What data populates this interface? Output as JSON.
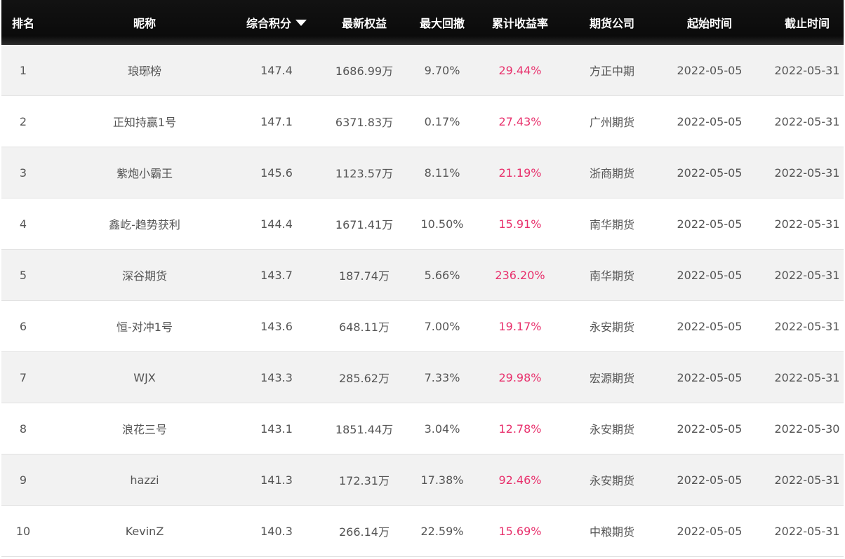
{
  "columns": {
    "rank": "排名",
    "nickname": "昵称",
    "score": "综合积分",
    "equity": "最新权益",
    "drawdown": "最大回撤",
    "return": "累计收益率",
    "company": "期货公司",
    "start": "起始时间",
    "end": "截止时间"
  },
  "sort_icon": "sort-desc-caret",
  "colors": {
    "header_bg": "#0b0b0b",
    "gain_text": "#e8306c",
    "row_alt": "#f2f2f2"
  },
  "rows": [
    {
      "rank": "1",
      "nickname": "琅琊榜",
      "score": "147.4",
      "equity": "1686.99万",
      "drawdown": "9.70%",
      "return": "29.44%",
      "company": "方正中期",
      "start": "2022-05-05",
      "end": "2022-05-31"
    },
    {
      "rank": "2",
      "nickname": "正知持赢1号",
      "score": "147.1",
      "equity": "6371.83万",
      "drawdown": "0.17%",
      "return": "27.43%",
      "company": "广州期货",
      "start": "2022-05-05",
      "end": "2022-05-31"
    },
    {
      "rank": "3",
      "nickname": "紫炮小霸王",
      "score": "145.6",
      "equity": "1123.57万",
      "drawdown": "8.11%",
      "return": "21.19%",
      "company": "浙商期货",
      "start": "2022-05-05",
      "end": "2022-05-31"
    },
    {
      "rank": "4",
      "nickname": "鑫屹-趋势获利",
      "score": "144.4",
      "equity": "1671.41万",
      "drawdown": "10.50%",
      "return": "15.91%",
      "company": "南华期货",
      "start": "2022-05-05",
      "end": "2022-05-31"
    },
    {
      "rank": "5",
      "nickname": "深谷期货",
      "score": "143.7",
      "equity": "187.74万",
      "drawdown": "5.66%",
      "return": "236.20%",
      "company": "南华期货",
      "start": "2022-05-05",
      "end": "2022-05-31"
    },
    {
      "rank": "6",
      "nickname": "恒-对冲1号",
      "score": "143.6",
      "equity": "648.11万",
      "drawdown": "7.00%",
      "return": "19.17%",
      "company": "永安期货",
      "start": "2022-05-05",
      "end": "2022-05-31"
    },
    {
      "rank": "7",
      "nickname": "WJX",
      "score": "143.3",
      "equity": "285.62万",
      "drawdown": "7.33%",
      "return": "29.98%",
      "company": "宏源期货",
      "start": "2022-05-05",
      "end": "2022-05-31"
    },
    {
      "rank": "8",
      "nickname": "浪花三号",
      "score": "143.1",
      "equity": "1851.44万",
      "drawdown": "3.04%",
      "return": "12.78%",
      "company": "永安期货",
      "start": "2022-05-05",
      "end": "2022-05-30"
    },
    {
      "rank": "9",
      "nickname": "hazzi",
      "score": "141.3",
      "equity": "172.31万",
      "drawdown": "17.38%",
      "return": "92.46%",
      "company": "永安期货",
      "start": "2022-05-05",
      "end": "2022-05-31"
    },
    {
      "rank": "10",
      "nickname": "KevinZ",
      "score": "140.3",
      "equity": "266.14万",
      "drawdown": "22.59%",
      "return": "15.69%",
      "company": "中粮期货",
      "start": "2022-05-05",
      "end": "2022-05-31"
    }
  ]
}
